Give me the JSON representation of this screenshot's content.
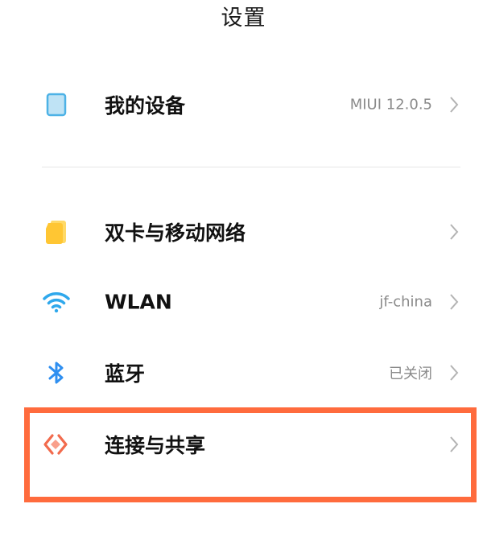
{
  "header": {
    "title": "设置"
  },
  "rows": [
    {
      "label": "我的设备",
      "value": "MIUI 12.0.5",
      "icon": "device-icon"
    },
    {
      "label": "双卡与移动网络",
      "value": "",
      "icon": "sim-card-icon"
    },
    {
      "label": "WLAN",
      "value": "jf-china",
      "icon": "wifi-icon"
    },
    {
      "label": "蓝牙",
      "value": "已关闭",
      "icon": "bluetooth-icon"
    },
    {
      "label": "连接与共享",
      "value": "",
      "icon": "connection-sharing-icon"
    }
  ],
  "colors": {
    "device": "#4db2e6",
    "sim": "#ffc633",
    "wifi": "#2fa8ec",
    "bluetooth": "#2f8ff0",
    "sharing": "#f26b4d",
    "highlight": "#ff6b3d"
  }
}
